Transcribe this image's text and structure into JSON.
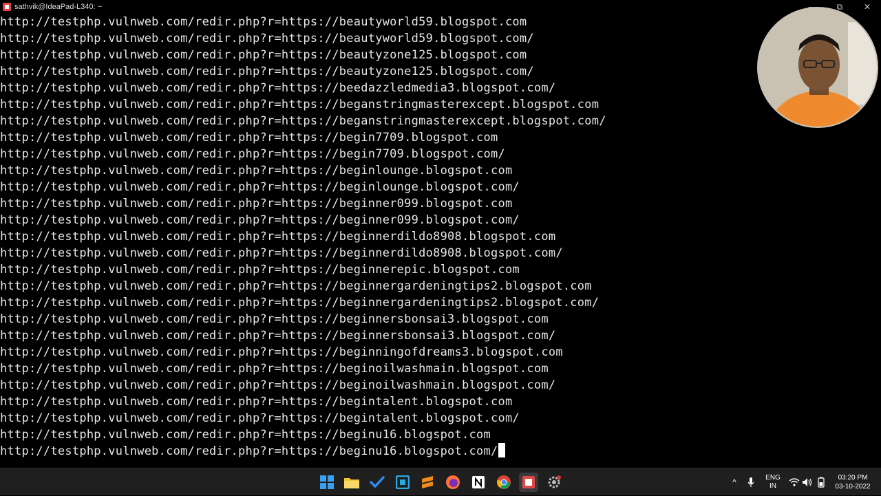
{
  "window": {
    "title": "sathvik@IdeaPad-L340: ~",
    "minimize": "—",
    "restore": "⧉",
    "close": "✕"
  },
  "terminal": {
    "lines": [
      "http://testphp.vulnweb.com/redir.php?r=https://beautyworld59.blogspot.com",
      "http://testphp.vulnweb.com/redir.php?r=https://beautyworld59.blogspot.com/",
      "http://testphp.vulnweb.com/redir.php?r=https://beautyzone125.blogspot.com",
      "http://testphp.vulnweb.com/redir.php?r=https://beautyzone125.blogspot.com/",
      "http://testphp.vulnweb.com/redir.php?r=https://beedazzledmedia3.blogspot.com/",
      "http://testphp.vulnweb.com/redir.php?r=https://beganstringmasterexcept.blogspot.com",
      "http://testphp.vulnweb.com/redir.php?r=https://beganstringmasterexcept.blogspot.com/",
      "http://testphp.vulnweb.com/redir.php?r=https://begin7709.blogspot.com",
      "http://testphp.vulnweb.com/redir.php?r=https://begin7709.blogspot.com/",
      "http://testphp.vulnweb.com/redir.php?r=https://beginlounge.blogspot.com",
      "http://testphp.vulnweb.com/redir.php?r=https://beginlounge.blogspot.com/",
      "http://testphp.vulnweb.com/redir.php?r=https://beginner099.blogspot.com",
      "http://testphp.vulnweb.com/redir.php?r=https://beginner099.blogspot.com/",
      "http://testphp.vulnweb.com/redir.php?r=https://beginnerdildo8908.blogspot.com",
      "http://testphp.vulnweb.com/redir.php?r=https://beginnerdildo8908.blogspot.com/",
      "http://testphp.vulnweb.com/redir.php?r=https://beginnerepic.blogspot.com",
      "http://testphp.vulnweb.com/redir.php?r=https://beginnergardeningtips2.blogspot.com",
      "http://testphp.vulnweb.com/redir.php?r=https://beginnergardeningtips2.blogspot.com/",
      "http://testphp.vulnweb.com/redir.php?r=https://beginnersbonsai3.blogspot.com",
      "http://testphp.vulnweb.com/redir.php?r=https://beginnersbonsai3.blogspot.com/",
      "http://testphp.vulnweb.com/redir.php?r=https://beginningofdreams3.blogspot.com",
      "http://testphp.vulnweb.com/redir.php?r=https://beginoilwashmain.blogspot.com",
      "http://testphp.vulnweb.com/redir.php?r=https://beginoilwashmain.blogspot.com/",
      "http://testphp.vulnweb.com/redir.php?r=https://begintalent.blogspot.com",
      "http://testphp.vulnweb.com/redir.php?r=https://begintalent.blogspot.com/",
      "http://testphp.vulnweb.com/redir.php?r=https://beginu16.blogspot.com",
      "http://testphp.vulnweb.com/redir.php?r=https://beginu16.blogspot.com/"
    ]
  },
  "taskbar": {
    "apps": [
      "windows-start-icon",
      "file-explorer-icon",
      "todo-check-icon",
      "screen-capture-icon",
      "sublime-text-icon",
      "firefox-icon",
      "notion-icon",
      "chrome-icon",
      "terminal-app-icon",
      "settings-gear-icon"
    ],
    "tray": {
      "chevron": "^",
      "language_line1": "ENG",
      "language_line2": "IN",
      "time": "03:20 PM",
      "date": "03-10-2022"
    }
  },
  "colors": {
    "terminal_bg": "#000000",
    "terminal_fg": "#e6e6e6",
    "taskbar_bg": "#1f1f1f",
    "accent_red": "#e04848"
  }
}
